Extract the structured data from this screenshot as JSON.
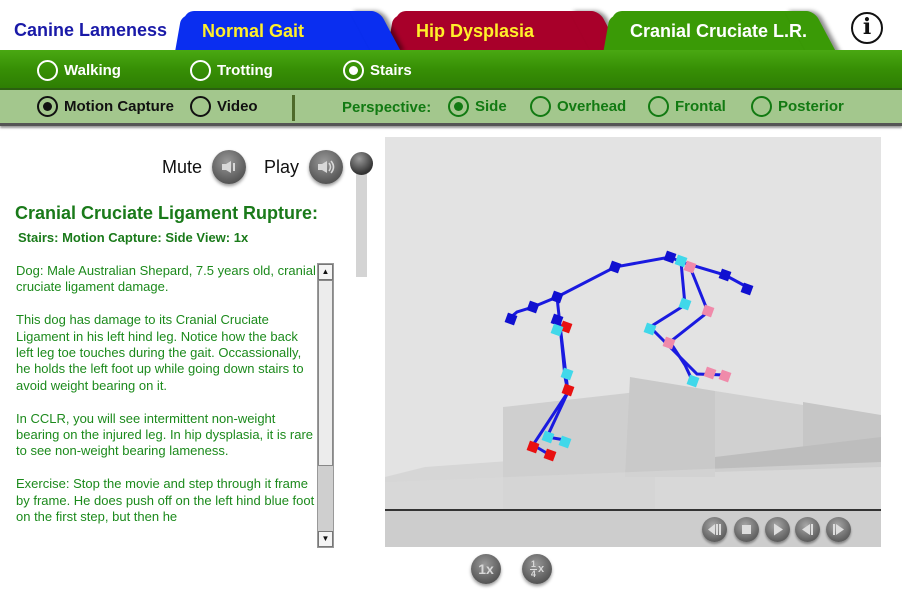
{
  "app": {
    "title": "Canine Lameness"
  },
  "tabs": [
    {
      "label": "Normal Gait",
      "color": "#0a2ef0",
      "text_color": "#ffef2a",
      "active": false
    },
    {
      "label": "Hip Dysplasia",
      "color": "#a8002a",
      "text_color": "#ffef2a",
      "active": false
    },
    {
      "label": "Cranial Cruciate L.R.",
      "color": "#3a9a06",
      "text_color": "#ffffff",
      "active": true
    }
  ],
  "info_button": {
    "icon": "info-icon",
    "glyph": "i"
  },
  "gait_options": [
    {
      "label": "Walking",
      "selected": false
    },
    {
      "label": "Trotting",
      "selected": false
    },
    {
      "label": "Stairs",
      "selected": true
    }
  ],
  "mode_options": [
    {
      "label": "Motion Capture",
      "selected": true
    },
    {
      "label": "Video",
      "selected": false
    }
  ],
  "perspective": {
    "label": "Perspective:",
    "options": [
      {
        "label": "Side",
        "selected": true
      },
      {
        "label": "Overhead",
        "selected": false
      },
      {
        "label": "Frontal",
        "selected": false
      },
      {
        "label": "Posterior",
        "selected": false
      }
    ]
  },
  "audio": {
    "mute_label": "Mute",
    "play_label": "Play",
    "mute_icon": "speaker-mute-icon",
    "play_icon": "speaker-play-icon",
    "volume_level": 1.0
  },
  "content": {
    "title": "Cranial Cruciate Ligament Rupture:",
    "subtitle": "Stairs: Motion Capture: Side View: 1x",
    "paragraphs": [
      "Dog: Male Australian Shepard, 7.5 years old, cranial cruciate ligament damage.",
      "This dog has damage to its Cranial Cruciate Ligament in his left hind leg. Notice how the back left leg toe touches during the gait. Occassionally, he holds the left foot up while going down stairs to avoid weight bearing on it.",
      "In CCLR, you will see intermittent non-weight bearing on the injured leg. In hip dysplasia, it is rare to see non-weight bearing lameness.",
      "Exercise: Stop the movie and step through it frame by frame. He does push off on the left hind blue foot on the first step, but then he"
    ],
    "scroll_up_glyph": "▲",
    "scroll_down_glyph": "▼"
  },
  "player": {
    "controls": [
      {
        "name": "rewind-button",
        "icon": "rewind-icon"
      },
      {
        "name": "stop-button",
        "icon": "stop-icon"
      },
      {
        "name": "play-button",
        "icon": "play-icon"
      },
      {
        "name": "step-back-button",
        "icon": "step-back-icon"
      },
      {
        "name": "step-forward-button",
        "icon": "step-forward-icon"
      }
    ],
    "speed_normal_label": "1x",
    "speed_quarter_num": "1",
    "speed_quarter_den": "4",
    "speed_quarter_suffix": "x"
  },
  "skeleton_colors": {
    "spine": "#1010d0",
    "left_hind": "#e81010",
    "right_hind": "#40d8ea",
    "fore": "#f08aaa",
    "bone": "#1a1ae0"
  }
}
